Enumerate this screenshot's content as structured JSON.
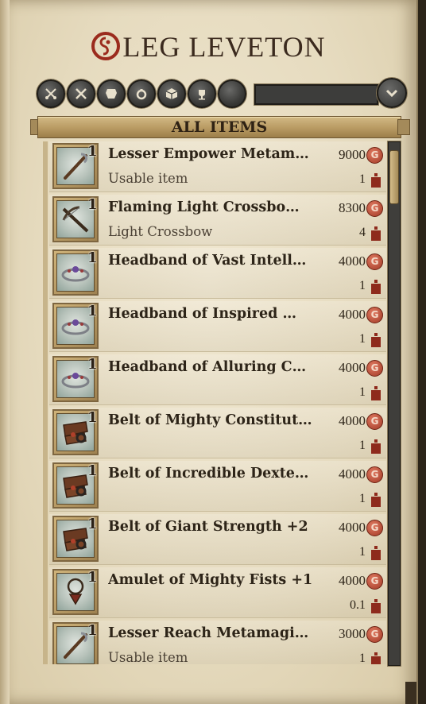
{
  "vendor": {
    "title_initial": "O",
    "title_rest": "LEG LEVETON"
  },
  "filters": [
    "all-items",
    "weapons",
    "armor",
    "accessories",
    "usables",
    "other",
    "non-usable"
  ],
  "section": {
    "label": "ALL ITEMS"
  },
  "colors": {
    "accent": "#b89a62",
    "coin": "#a23a26",
    "weight": "#8e2a1c"
  },
  "items": [
    {
      "qty": "1",
      "name": "Lesser Empower Metam…",
      "type": "Usable item",
      "price": "9000",
      "weight": "1",
      "icon": "metamagic-rod-icon"
    },
    {
      "qty": "1",
      "name": "Flaming Light Crossbo…",
      "type": "Light Crossbow",
      "price": "8300",
      "weight": "4",
      "icon": "crossbow-icon"
    },
    {
      "qty": "1",
      "name": "Headband of Vast Intell…",
      "type": "",
      "price": "4000",
      "weight": "1",
      "icon": "headband-icon"
    },
    {
      "qty": "1",
      "name": "Headband of Inspired …",
      "type": "",
      "price": "4000",
      "weight": "1",
      "icon": "headband-icon"
    },
    {
      "qty": "1",
      "name": "Headband of Alluring C…",
      "type": "",
      "price": "4000",
      "weight": "1",
      "icon": "headband-icon"
    },
    {
      "qty": "1",
      "name": "Belt of Mighty Constitut…",
      "type": "",
      "price": "4000",
      "weight": "1",
      "icon": "belt-icon"
    },
    {
      "qty": "1",
      "name": "Belt of Incredible Dexte…",
      "type": "",
      "price": "4000",
      "weight": "1",
      "icon": "belt-icon"
    },
    {
      "qty": "1",
      "name": "Belt of Giant Strength +2",
      "type": "",
      "price": "4000",
      "weight": "1",
      "icon": "belt-icon"
    },
    {
      "qty": "1",
      "name": "Amulet of Mighty Fists +1",
      "type": "",
      "price": "4000",
      "weight": "0.1",
      "icon": "amulet-icon"
    },
    {
      "qty": "1",
      "name": "Lesser Reach Metamagic…",
      "type": "Usable item",
      "price": "3000",
      "weight": "1",
      "icon": "metamagic-rod-icon"
    }
  ]
}
